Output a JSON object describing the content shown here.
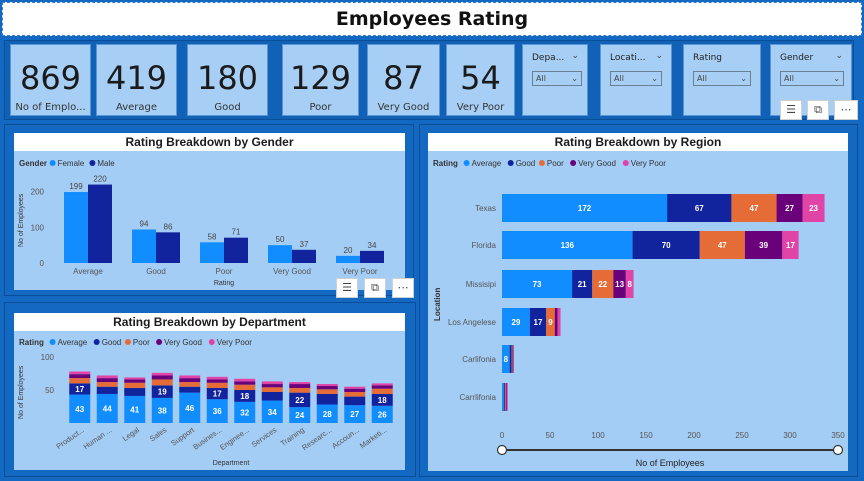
{
  "header": {
    "title": "Employees Rating"
  },
  "kpis": [
    {
      "value": "869",
      "label": "No of Emplo..."
    },
    {
      "value": "419",
      "label": "Average"
    },
    {
      "value": "180",
      "label": "Good"
    },
    {
      "value": "129",
      "label": "Poor"
    },
    {
      "value": "87",
      "label": "Very Good"
    },
    {
      "value": "54",
      "label": "Very Poor"
    }
  ],
  "slicers": [
    {
      "label": "Depa...",
      "value": "All"
    },
    {
      "label": "Locati...",
      "value": "All"
    },
    {
      "label": "Rating",
      "value": "All"
    },
    {
      "label": "Gender",
      "value": "All"
    }
  ],
  "icons": {
    "filter": "filter-icon",
    "focus": "focus-mode-icon",
    "more": "more-options-icon"
  },
  "colors": {
    "average": "#118dff",
    "good": "#12239e",
    "poor": "#e66c37",
    "very_good": "#6b007b",
    "very_poor": "#e044a7",
    "female": "#118dff",
    "male": "#12239e"
  },
  "chart_data": [
    {
      "type": "bar",
      "title": "Rating Breakdown by Gender",
      "legend_title": "Gender",
      "xlabel": "Rating",
      "ylabel": "No of Employees",
      "categories": [
        "Average",
        "Good",
        "Poor",
        "Very Good",
        "Very Poor"
      ],
      "series": [
        {
          "name": "Female",
          "values": [
            199,
            94,
            58,
            50,
            20
          ]
        },
        {
          "name": "Male",
          "values": [
            220,
            86,
            71,
            37,
            34
          ]
        }
      ],
      "yticks": [
        "0",
        "100",
        "200"
      ],
      "ylim": [
        0,
        230
      ]
    },
    {
      "type": "bar",
      "title": "Rating Breakdown by Department",
      "legend_title": "Rating",
      "xlabel": "Department",
      "ylabel": "No of Employees",
      "categories": [
        "Product...",
        "Human ...",
        "Legal",
        "Sales",
        "Support",
        "Busines...",
        "Enginee...",
        "Services",
        "Training",
        "Researc...",
        "Accoun...",
        "Marketi..."
      ],
      "series": [
        {
          "name": "Average",
          "values": [
            43,
            44,
            41,
            38,
            46,
            36,
            32,
            34,
            24,
            28,
            27,
            26
          ],
          "labels": [
            "43",
            "44",
            "41",
            "38",
            "46",
            "36",
            "32",
            "34",
            "24",
            "28",
            "27",
            "26"
          ]
        },
        {
          "name": "Good",
          "values": [
            17,
            11,
            12,
            19,
            9,
            17,
            18,
            13,
            22,
            16,
            13,
            18
          ],
          "labels": [
            "17",
            "",
            "",
            "19",
            "",
            "17",
            "18",
            "",
            "22",
            "",
            "",
            "18"
          ]
        },
        {
          "name": "Poor",
          "values": [
            8,
            7,
            8,
            9,
            7,
            8,
            8,
            7,
            7,
            7,
            7,
            8
          ],
          "labels": []
        },
        {
          "name": "Very Good",
          "values": [
            6,
            6,
            5,
            6,
            6,
            5,
            5,
            5,
            6,
            5,
            5,
            5
          ],
          "labels": []
        },
        {
          "name": "Very Poor",
          "values": [
            4,
            4,
            3,
            4,
            4,
            4,
            4,
            4,
            3,
            3,
            3,
            3
          ],
          "labels": []
        }
      ],
      "yticks": [
        "50",
        "100"
      ],
      "ylim": [
        0,
        100
      ]
    },
    {
      "type": "bar",
      "orientation": "horizontal",
      "title": "Rating Breakdown by Region",
      "legend_title": "Rating",
      "xlabel": "No of Employees",
      "ylabel": "Location",
      "categories": [
        "Texas",
        "Florida",
        "Missisipi",
        "Los Angelese",
        "Carlifonia",
        "Carrlifonia"
      ],
      "series": [
        {
          "name": "Average",
          "values": [
            172,
            136,
            73,
            29,
            8,
            2
          ],
          "labels": [
            "172",
            "136",
            "73",
            "29",
            "8",
            ""
          ]
        },
        {
          "name": "Good",
          "values": [
            67,
            70,
            21,
            17,
            2,
            1
          ],
          "labels": [
            "67",
            "70",
            "21",
            "17",
            "",
            ""
          ]
        },
        {
          "name": "Poor",
          "values": [
            47,
            47,
            22,
            9,
            1,
            1
          ],
          "labels": [
            "47",
            "47",
            "22",
            "9",
            "",
            ""
          ]
        },
        {
          "name": "Very Good",
          "values": [
            27,
            39,
            13,
            3,
            1,
            1
          ],
          "labels": [
            "27",
            "39",
            "13",
            "",
            "",
            ""
          ]
        },
        {
          "name": "Very Poor",
          "values": [
            23,
            17,
            8,
            3,
            0,
            1
          ],
          "labels": [
            "23",
            "17",
            "8",
            "",
            "",
            ""
          ]
        }
      ],
      "xticks": [
        "0",
        "50",
        "100",
        "150",
        "200",
        "250",
        "300",
        "350"
      ],
      "xlim": [
        0,
        350
      ]
    }
  ]
}
